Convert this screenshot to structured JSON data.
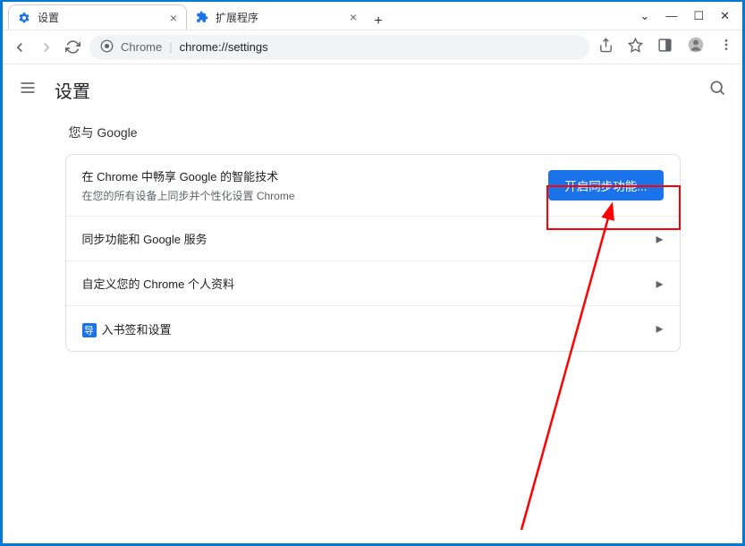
{
  "tabs": [
    {
      "title": "设置",
      "icon": "gear"
    },
    {
      "title": "扩展程序",
      "icon": "extension"
    }
  ],
  "address": {
    "app": "Chrome",
    "url": "chrome://settings"
  },
  "page": {
    "title": "设置"
  },
  "section": {
    "title": "您与 Google"
  },
  "sync": {
    "title": "在 Chrome 中畅享 Google 的智能技术",
    "subtitle": "在您的所有设备上同步并个性化设置 Chrome",
    "button": "开启同步功能..."
  },
  "rows": [
    {
      "label": "同步功能和 Google 服务"
    },
    {
      "label": "自定义您的 Chrome 个人资料"
    },
    {
      "label": "入书签和设置",
      "prefix_icon": "导"
    }
  ]
}
